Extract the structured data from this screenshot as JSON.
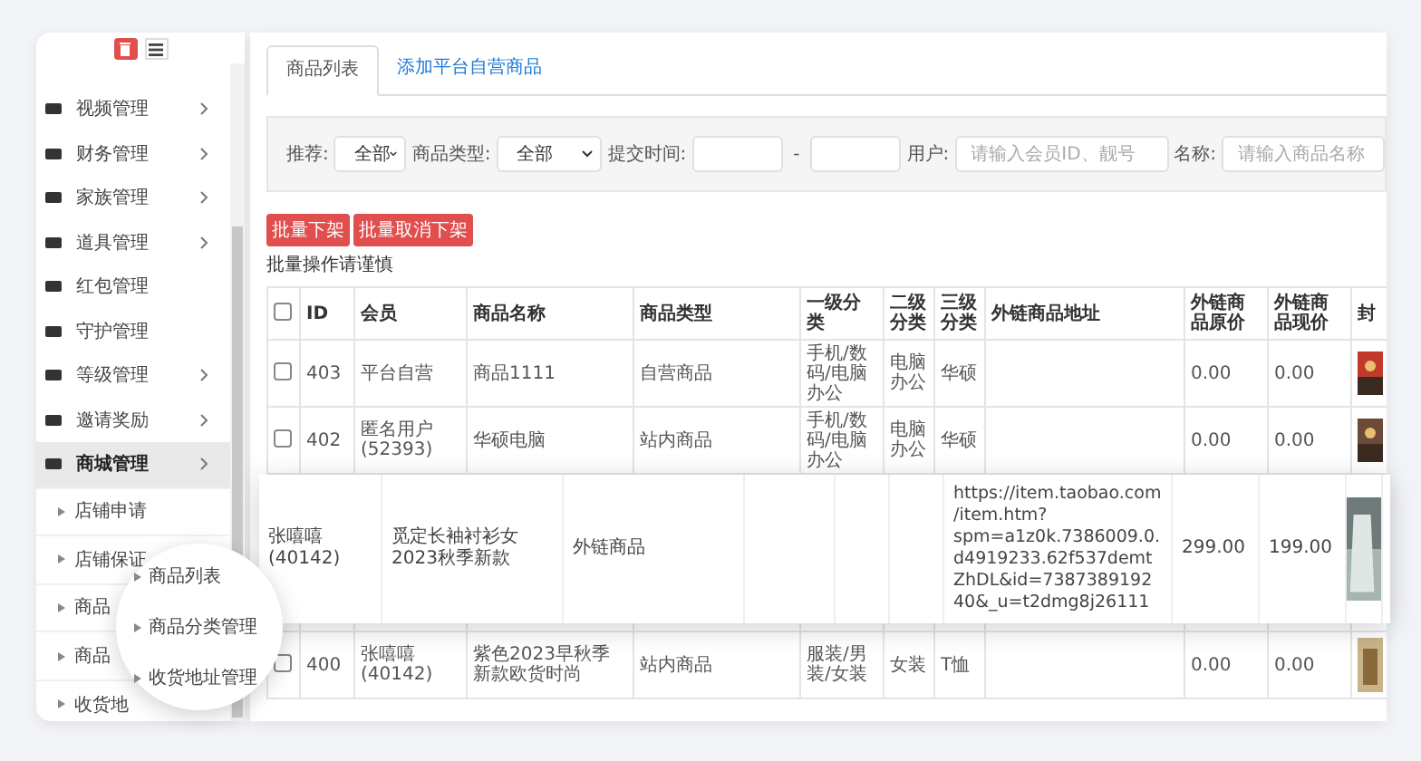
{
  "sidebar": {
    "items": [
      {
        "label": "视频管理",
        "has_children": true,
        "active": false
      },
      {
        "label": "财务管理",
        "has_children": true,
        "active": false
      },
      {
        "label": "家族管理",
        "has_children": true,
        "active": false
      },
      {
        "label": "道具管理",
        "has_children": true,
        "active": false
      },
      {
        "label": "红包管理",
        "has_children": false,
        "active": false
      },
      {
        "label": "守护管理",
        "has_children": false,
        "active": false
      },
      {
        "label": "等级管理",
        "has_children": true,
        "active": false
      },
      {
        "label": "邀请奖励",
        "has_children": true,
        "active": false
      },
      {
        "label": "商城管理",
        "has_children": true,
        "active": true
      }
    ],
    "subitems": [
      "店铺申请",
      "店铺保证",
      "商品",
      "商品",
      "收货地"
    ],
    "magnifier": [
      "商品列表",
      "商品分类管理",
      "收货地址管理"
    ]
  },
  "tabs": [
    {
      "label": "商品列表",
      "selected": true
    },
    {
      "label": "添加平台自营商品",
      "selected": false
    }
  ],
  "filters": {
    "recommend_label": "推荐:",
    "recommend_value": "全部",
    "type_label": "商品类型:",
    "type_value": "全部",
    "time_label": "提交时间:",
    "time_separator": "-",
    "user_label": "用户:",
    "user_placeholder": "请输入会员ID、靓号",
    "name_label": "名称:",
    "name_placeholder": "请输入商品名称"
  },
  "actions": [
    "批量下架",
    "批量取消下架"
  ],
  "warning": "批量操作请谨慎",
  "table": {
    "select_all_checked": false,
    "columns": [
      "ID",
      "会员",
      "商品名称",
      "商品类型",
      "一级分类",
      "二级分类",
      "三级分类",
      "外链商品地址",
      "外链商品原价",
      "外链商品现价",
      "封"
    ],
    "rows": [
      {
        "checked": false,
        "cells": [
          "403",
          "平台自营",
          "商品1111",
          "自营商品",
          "手机/数码/电脑办公",
          "电脑办公",
          "华硕",
          "",
          "0.00",
          "0.00"
        ]
      },
      {
        "checked": false,
        "cells": [
          "402",
          "匿名用户(52393)",
          "华硕电脑",
          "站内商品",
          "手机/数码/电脑办公",
          "电脑办公",
          "华硕",
          "",
          "0.00",
          "0.00"
        ]
      }
    ],
    "highlighted_row": {
      "cells": [
        "张嘻嘻(40142)",
        "觅定长袖衬衫女2023秋季新款",
        "外链商品",
        "",
        "",
        "",
        "https://item.taobao.com/item.htm?spm=a1z0k.7386009.0.d4919233.62f537demtZhDL&id=738738919240&_u=t2dmg8j26111",
        "299.00",
        "199.00"
      ]
    },
    "rows_below": [
      {
        "checked": false,
        "cells": [
          "400",
          "张嘻嘻(40142)",
          "紫色2023早秋季新款欧货时尚",
          "站内商品",
          "服装/男装/女装",
          "女装",
          "T恤",
          "",
          "0.00",
          "0.00"
        ]
      }
    ]
  }
}
